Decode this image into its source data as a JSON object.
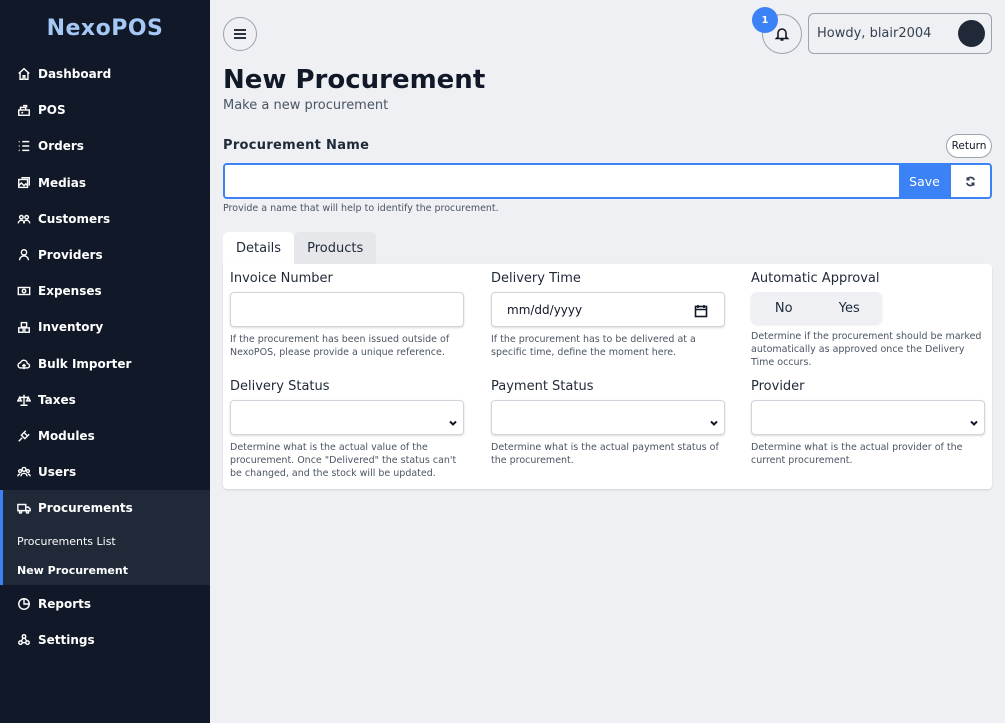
{
  "app": {
    "logo": "NexoPOS"
  },
  "sidebar": {
    "items": [
      {
        "label": "Dashboard",
        "icon": "home-icon"
      },
      {
        "label": "POS",
        "icon": "cash-register-icon"
      },
      {
        "label": "Orders",
        "icon": "list-icon"
      },
      {
        "label": "Medias",
        "icon": "image-icon"
      },
      {
        "label": "Customers",
        "icon": "users-group-icon"
      },
      {
        "label": "Providers",
        "icon": "user-icon"
      },
      {
        "label": "Expenses",
        "icon": "money-icon"
      },
      {
        "label": "Inventory",
        "icon": "boxes-icon"
      },
      {
        "label": "Bulk Importer",
        "icon": "cloud-upload-icon"
      },
      {
        "label": "Taxes",
        "icon": "balance-scale-icon"
      },
      {
        "label": "Modules",
        "icon": "plug-icon"
      },
      {
        "label": "Users",
        "icon": "users-icon"
      }
    ],
    "procurements": {
      "label": "Procurements",
      "icon": "truck-icon",
      "sub": [
        "Procurements List",
        "New Procurement"
      ]
    },
    "bottom": [
      {
        "label": "Reports",
        "icon": "chart-pie-icon"
      },
      {
        "label": "Settings",
        "icon": "settings-icon"
      }
    ]
  },
  "header": {
    "notification_count": "1",
    "greeting": "Howdy, blair2004"
  },
  "page": {
    "title": "New Procurement",
    "subtitle": "Make a new procurement"
  },
  "form": {
    "name_label": "Procurement Name",
    "name_value": "",
    "return_label": "Return",
    "save_label": "Save",
    "name_help": "Provide a name that will help to identify the procurement.",
    "tabs": [
      "Details",
      "Products"
    ],
    "fields": {
      "invoice": {
        "label": "Invoice Number",
        "value": "",
        "help": "If the procurement has been issued outside of NexoPOS, please provide a unique reference."
      },
      "delivery_time": {
        "label": "Delivery Time",
        "value": "mm/dd/yyyy",
        "help": "If the procurement has to be delivered at a specific time, define the moment here."
      },
      "approval": {
        "label": "Automatic Approval",
        "options": [
          "No",
          "Yes"
        ],
        "help": "Determine if the procurement should be marked automatically as approved once the Delivery Time occurs."
      },
      "delivery_status": {
        "label": "Delivery Status",
        "value": "",
        "help": "Determine what is the actual value of the procurement. Once \"Delivered\" the status can't be changed, and the stock will be updated."
      },
      "payment_status": {
        "label": "Payment Status",
        "value": "",
        "help": "Determine what is the actual payment status of the procurement."
      },
      "provider": {
        "label": "Provider",
        "value": "",
        "help": "Determine what is the actual provider of the current procurement."
      }
    }
  },
  "colors": {
    "sidebar_bg": "#111827",
    "accent": "#3b82f6",
    "logo": "#a5c8f5"
  }
}
